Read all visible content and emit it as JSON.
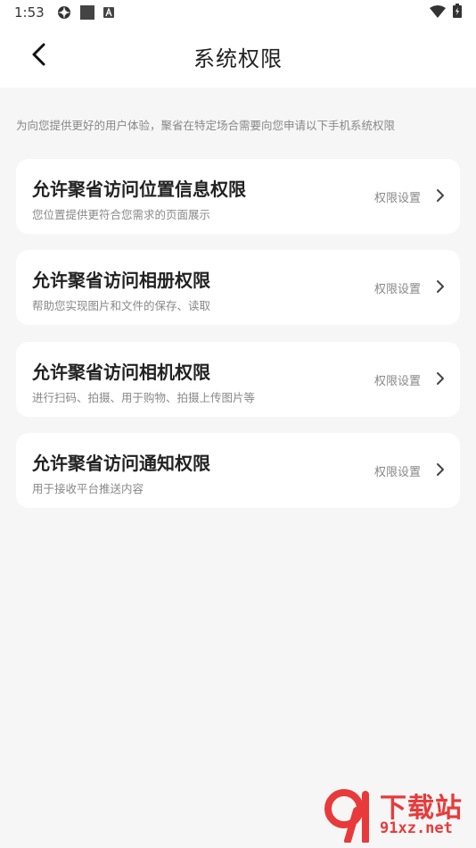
{
  "status_bar": {
    "time": "1:53",
    "icons_left": [
      "settings-icon",
      "square-icon",
      "a-icon"
    ],
    "icons_right": [
      "wifi-icon",
      "battery-charging-icon"
    ]
  },
  "header": {
    "title": "系统权限",
    "back_icon": "chevron-left-icon"
  },
  "intro_text": "为向您提供更好的用户体验，聚省在特定场合需要向您申请以下手机系统权限",
  "permissions": [
    {
      "title": "允许聚省访问位置信息权限",
      "description": "您位置提供更符合您需求的页面展示",
      "action": "权限设置"
    },
    {
      "title": "允许聚省访问相册权限",
      "description": "帮助您实现图片和文件的保存、读取",
      "action": "权限设置"
    },
    {
      "title": "允许聚省访问相机权限",
      "description": "进行扫码、拍摄、用于购物、拍摄上传图片等",
      "action": "权限设置"
    },
    {
      "title": "允许聚省访问通知权限",
      "description": "用于接收平台推送内容",
      "action": "权限设置"
    }
  ],
  "watermark": {
    "text": "下载站",
    "url": "91xz.net"
  },
  "colors": {
    "background": "#f6f6f6",
    "card": "#ffffff",
    "text_primary": "#222222",
    "text_secondary": "#888888",
    "watermark": "#e83a3a"
  }
}
